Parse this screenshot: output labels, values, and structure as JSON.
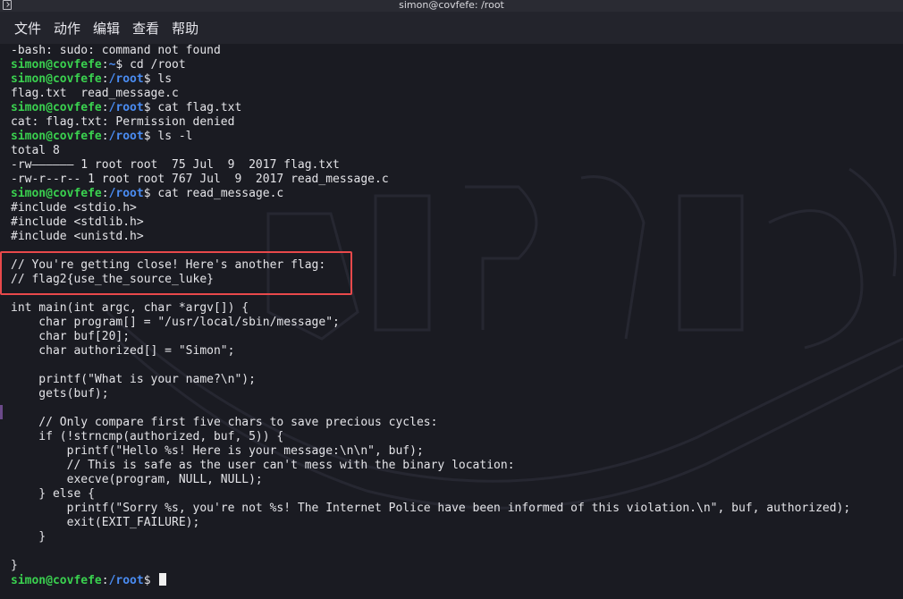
{
  "window": {
    "title": "simon@covfefe: /root",
    "icon": "terminal-icon"
  },
  "menu": [
    "文件",
    "动作",
    "编辑",
    "查看",
    "帮助"
  ],
  "prompt": {
    "user_host": "simon@covfefe",
    "sep": ":",
    "dollar": "$ "
  },
  "lines": [
    {
      "kind": "out",
      "text": "-bash: sudo: command not found"
    },
    {
      "kind": "cmd",
      "path": "~",
      "cmd": "cd /root"
    },
    {
      "kind": "cmd",
      "path": "/root",
      "cmd": "ls"
    },
    {
      "kind": "out",
      "text": "flag.txt  read_message.c"
    },
    {
      "kind": "cmd",
      "path": "/root",
      "cmd": "cat flag.txt"
    },
    {
      "kind": "out",
      "text": "cat: flag.txt: Permission denied"
    },
    {
      "kind": "cmd",
      "path": "/root",
      "cmd": "ls -l"
    },
    {
      "kind": "out",
      "text": "total 8"
    },
    {
      "kind": "out",
      "text": "-rw—————— 1 root root  75 Jul  9  2017 flag.txt"
    },
    {
      "kind": "out",
      "text": "-rw-r--r-- 1 root root 767 Jul  9  2017 read_message.c"
    },
    {
      "kind": "cmd",
      "path": "/root",
      "cmd": "cat read_message.c"
    },
    {
      "kind": "out",
      "text": "#include <stdio.h>"
    },
    {
      "kind": "out",
      "text": "#include <stdlib.h>"
    },
    {
      "kind": "out",
      "text": "#include <unistd.h>"
    },
    {
      "kind": "out",
      "text": ""
    },
    {
      "kind": "out",
      "text": "// You're getting close! Here's another flag:"
    },
    {
      "kind": "out",
      "text": "// flag2{use_the_source_luke}"
    },
    {
      "kind": "out",
      "text": ""
    },
    {
      "kind": "out",
      "text": "int main(int argc, char *argv[]) {"
    },
    {
      "kind": "out",
      "text": "    char program[] = \"/usr/local/sbin/message\";"
    },
    {
      "kind": "out",
      "text": "    char buf[20];"
    },
    {
      "kind": "out",
      "text": "    char authorized[] = \"Simon\";"
    },
    {
      "kind": "out",
      "text": ""
    },
    {
      "kind": "out",
      "text": "    printf(\"What is your name?\\n\");"
    },
    {
      "kind": "out",
      "text": "    gets(buf);"
    },
    {
      "kind": "out",
      "text": ""
    },
    {
      "kind": "out",
      "text": "    // Only compare first five chars to save precious cycles:"
    },
    {
      "kind": "out",
      "text": "    if (!strncmp(authorized, buf, 5)) {"
    },
    {
      "kind": "out",
      "text": "        printf(\"Hello %s! Here is your message:\\n\\n\", buf);"
    },
    {
      "kind": "out",
      "text": "        // This is safe as the user can't mess with the binary location:"
    },
    {
      "kind": "out",
      "text": "        execve(program, NULL, NULL);"
    },
    {
      "kind": "out",
      "text": "    } else {"
    },
    {
      "kind": "out",
      "text": "        printf(\"Sorry %s, you're not %s! The Internet Police have been informed of this violation.\\n\", buf, authorized);"
    },
    {
      "kind": "out",
      "text": "        exit(EXIT_FAILURE);"
    },
    {
      "kind": "out",
      "text": "    }"
    },
    {
      "kind": "out",
      "text": ""
    },
    {
      "kind": "out",
      "text": "}"
    },
    {
      "kind": "cmd",
      "path": "/root",
      "cmd": "",
      "cursor": true
    }
  ],
  "highlight": {
    "first_line": 15,
    "last_line": 16,
    "color": "#e8494b"
  },
  "colors": {
    "background": "#1a1b22",
    "user": "#3ad14f",
    "path": "#4a8cf2",
    "text": "#e4e4e8"
  }
}
